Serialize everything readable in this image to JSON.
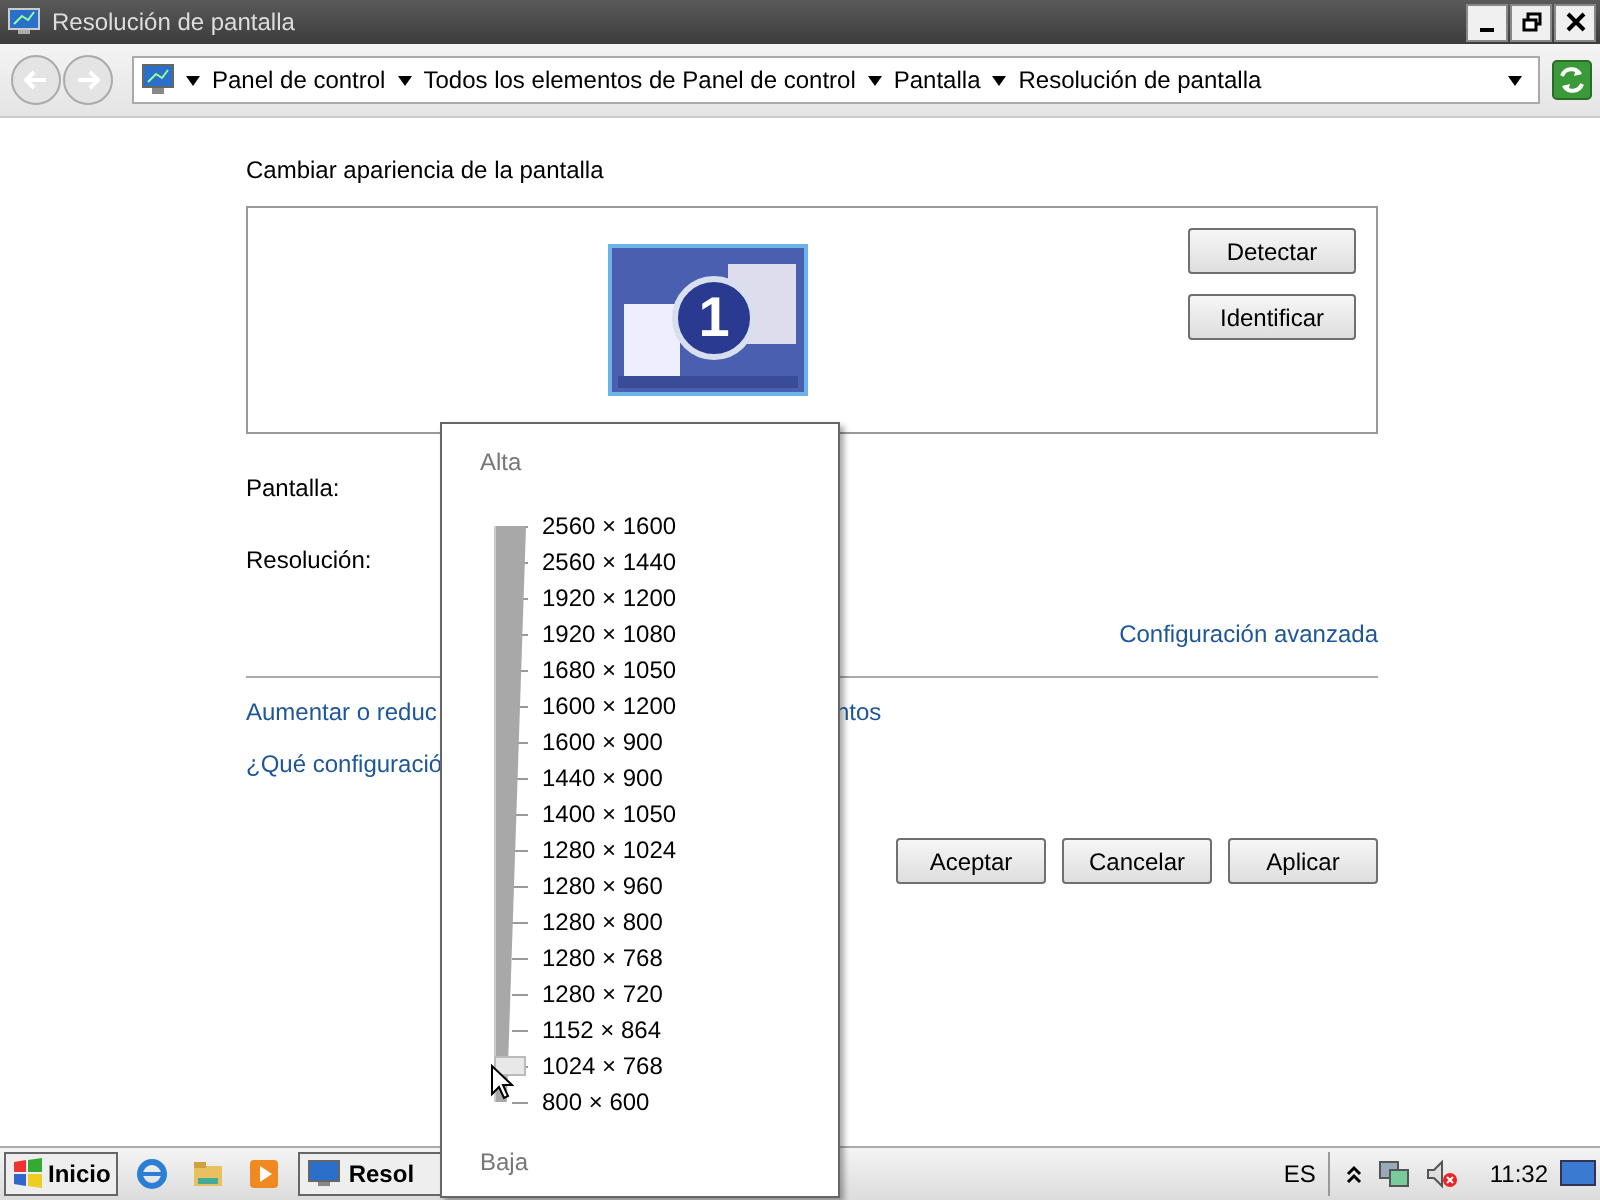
{
  "window": {
    "title": "Resolución de pantalla"
  },
  "address_bar": {
    "breadcrumbs": [
      "Panel de control",
      "Todos los elementos de Panel de control",
      "Pantalla",
      "Resolución de pantalla"
    ]
  },
  "heading": "Cambiar apariencia de la pantalla",
  "monitor": {
    "number": "1"
  },
  "side_buttons": [
    "Detectar",
    "Identificar"
  ],
  "fields": [
    {
      "label": "Pantalla:"
    },
    {
      "label": "Resolución:"
    }
  ],
  "advanced_link": "Configuración avanzada",
  "links": [
    {
      "left": "Aumentar o reduc",
      "right": "ntos"
    },
    {
      "left": "¿Qué configuració"
    }
  ],
  "buttons": [
    "Aceptar",
    "Cancelar",
    "Aplicar"
  ],
  "resolution_popup": {
    "high_label": "Alta",
    "low_label": "Baja",
    "level": 0.0625,
    "resolutions": [
      "2560 × 1600",
      "2560 × 1440",
      "1920 × 1200",
      "1920 × 1080",
      "1680 × 1050",
      "1600 × 1200",
      "1600 × 900",
      "1440 × 900",
      "1400 × 1050",
      "1280 × 1024",
      "1280 × 960",
      "1280 × 800",
      "1280 × 768",
      "1280 × 720",
      "1152 × 864",
      "1024 × 768",
      "800 × 600"
    ]
  },
  "taskbar": {
    "start": "Inicio",
    "window_button": "Resol",
    "language": "ES",
    "clock": "11:32"
  }
}
